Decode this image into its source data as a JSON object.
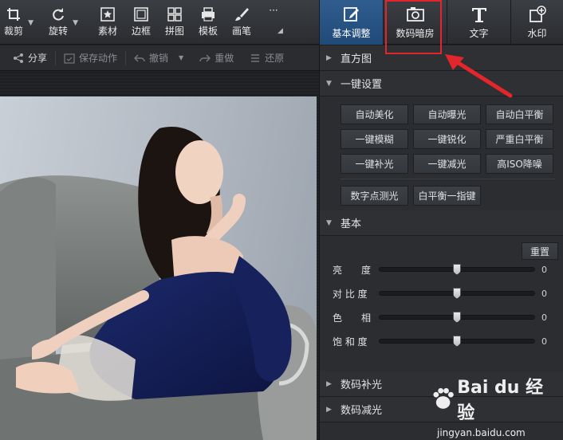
{
  "toolbar": {
    "tools": [
      {
        "label": "裁剪",
        "icon": "crop-icon"
      },
      {
        "label": "旋转",
        "icon": "rotate-icon"
      },
      {
        "label": "素材",
        "icon": "star-icon"
      },
      {
        "label": "边框",
        "icon": "frame-icon"
      },
      {
        "label": "拼图",
        "icon": "grid-icon"
      },
      {
        "label": "模板",
        "icon": "template-icon"
      },
      {
        "label": "画笔",
        "icon": "brush-icon"
      },
      {
        "label": "···",
        "icon": "more-icon"
      }
    ]
  },
  "tabs": [
    {
      "label": "基本调整",
      "icon": "edit-icon",
      "active": true
    },
    {
      "label": "数码暗房",
      "icon": "camera-icon",
      "active": false
    },
    {
      "label": "文字",
      "icon": "text-icon",
      "active": false
    },
    {
      "label": "水印",
      "icon": "watermark-icon",
      "active": false
    }
  ],
  "subbar": {
    "share": "分享",
    "save_action": "保存动作",
    "undo": "撤销",
    "redo": "重做",
    "restore": "还原"
  },
  "panel": {
    "histogram": "直方图",
    "one_key": {
      "title": "一键设置",
      "buttons": [
        [
          "自动美化",
          "自动曝光",
          "自动白平衡"
        ],
        [
          "一键模糊",
          "一键锐化",
          "严重白平衡"
        ],
        [
          "一键补光",
          "一键减光",
          "高ISO降噪"
        ]
      ],
      "extra_buttons": [
        "数字点测光",
        "白平衡一指键"
      ]
    },
    "basic": {
      "title": "基本",
      "reset": "重置",
      "sliders": [
        {
          "name": "亮　　度",
          "value": "0",
          "level": 0.5
        },
        {
          "name": "对 比 度",
          "value": "0",
          "level": 0.5
        },
        {
          "name": "色　　相",
          "value": "0",
          "level": 0.5
        },
        {
          "name": "饱 和 度",
          "value": "0",
          "level": 0.5
        }
      ]
    },
    "fill_light": "数码补光",
    "reduce_light": "数码减光"
  },
  "watermark": {
    "brand": "Bai du 经验",
    "url": "jingyan.baidu.com"
  },
  "colors": {
    "active_tab": "#2b5a8c",
    "highlight": "#e2262b"
  }
}
